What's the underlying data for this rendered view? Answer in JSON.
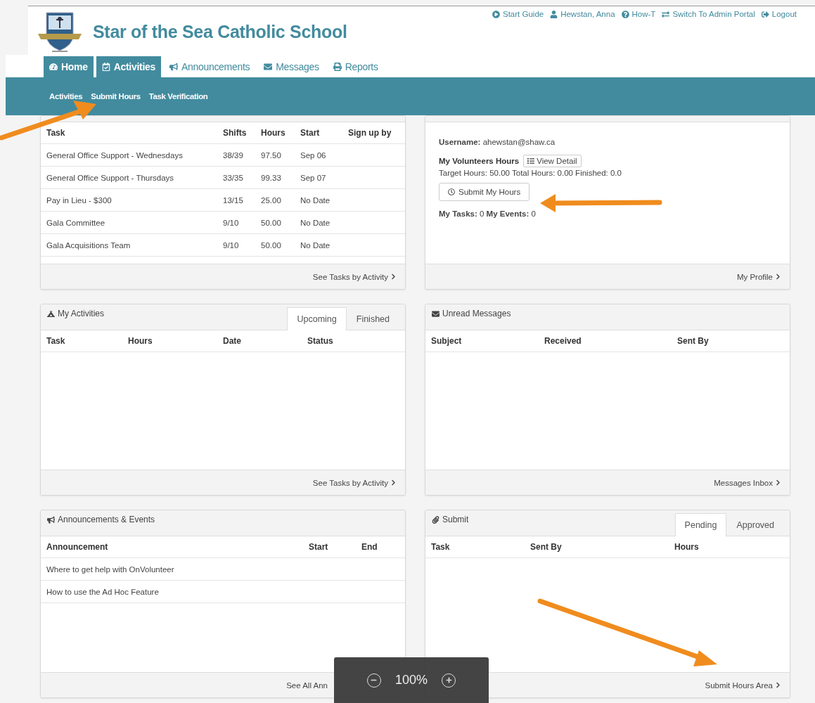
{
  "header": {
    "school_name": "Star of the Sea Catholic School",
    "top_links": [
      {
        "label": "Start Guide"
      },
      {
        "label": "Hewstan, Anna"
      },
      {
        "label": "How-T"
      },
      {
        "label": "Switch To Admin Portal"
      },
      {
        "label": "Logout"
      }
    ]
  },
  "nav_tabs": [
    {
      "label": "Home",
      "selected": true
    },
    {
      "label": "Activities",
      "selected": true
    },
    {
      "label": "Announcements",
      "selected": false
    },
    {
      "label": "Messages",
      "selected": false
    },
    {
      "label": "Reports",
      "selected": false
    }
  ],
  "sub_nav": [
    "Activities",
    "Submit Hours",
    "Task Verification"
  ],
  "panels": [
    {
      "kind": "table",
      "columns": [
        "Task",
        "Shifts",
        "Hours",
        "Start",
        "Sign up by"
      ],
      "rows": [
        [
          "General Office Support - Wednesdays",
          "38/39",
          "97.50",
          "Sep 06"
        ],
        [
          "General Office Support - Thursdays",
          "33/35",
          "99.33",
          "Sep 07"
        ],
        [
          "Pay in Lieu - $300",
          "13/15",
          "25.00",
          "No Date"
        ],
        [
          "Gala Committee",
          "9/10",
          "50.00",
          "No Date"
        ],
        [
          "Gala Acquisitions Team",
          "9/10",
          "50.00",
          "No Date"
        ]
      ],
      "footer_link": "See Tasks by Activity"
    },
    {
      "kind": "profile",
      "username": "**Username:** ahewstan@shaw.ca",
      "hours_label": "My Volunteers Hours",
      "view_detail": "View Detail",
      "summary": "Target Hours: 50.00 Total Hours: 0.00 Finished: 0.0",
      "submit_button": "Submit My Hours",
      "counts": "**My Tasks:** 0 **My Events:** 0",
      "footer_link": "My Profile"
    },
    {
      "kind": "table",
      "title": "My Activities",
      "tabs": [
        {
          "label": "Upcoming",
          "selected": true
        },
        {
          "label": "Finished",
          "selected": false
        }
      ],
      "columns": [
        "Task",
        "Hours",
        "Date",
        "Status"
      ],
      "footer_link": "See Tasks by Activity"
    },
    {
      "kind": "table",
      "title": "Unread Messages",
      "columns": [
        "Subject",
        "Received",
        "Sent By"
      ],
      "footer_link": "Messages Inbox"
    },
    {
      "kind": "table",
      "title": "Announcements & Events",
      "columns": [
        "Announcement",
        "Start",
        "End"
      ],
      "rows": [
        [
          "Where to get help with OnVolunteer"
        ],
        [
          "How to use the Ad Hoc Feature"
        ]
      ],
      "footer_link": "See All Ann"
    },
    {
      "kind": "table",
      "title": "Submit",
      "tabs": [
        {
          "label": "Pending",
          "selected": true
        },
        {
          "label": "Approved",
          "selected": false
        }
      ],
      "columns": [
        "Task",
        "Sent By",
        "Hours"
      ],
      "footer_link": "Submit Hours Area"
    }
  ],
  "zoom_overlay": {
    "level": "100%"
  }
}
